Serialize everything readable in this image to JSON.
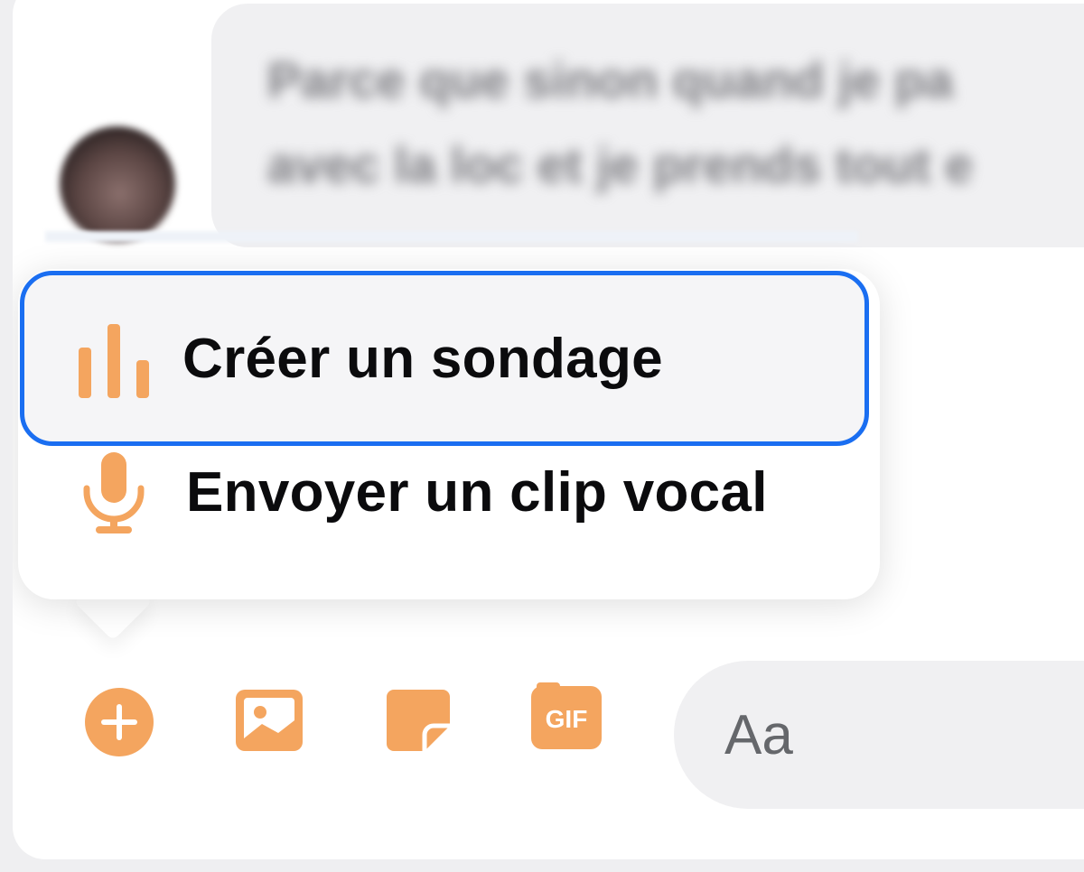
{
  "conversation": {
    "incoming_message": {
      "line1": "Parce que sinon quand je pa",
      "line2": "avec la loc et je prends tout e"
    }
  },
  "attachment_menu": {
    "items": [
      {
        "label": "Créer un sondage",
        "icon": "poll-icon",
        "highlighted": true
      },
      {
        "label": "Envoyer un clip vocal",
        "icon": "microphone-icon",
        "highlighted": false
      }
    ]
  },
  "composer": {
    "placeholder": "Aa",
    "tools": [
      "plus-circle-icon",
      "image-icon",
      "sticker-icon",
      "gif-icon"
    ],
    "gif_label": "GIF"
  },
  "colors": {
    "accent": "#f4a55f",
    "focus_ring": "#1a6ef1",
    "bubble_bg": "#f0f0f2",
    "text": "#0b0b0d"
  }
}
